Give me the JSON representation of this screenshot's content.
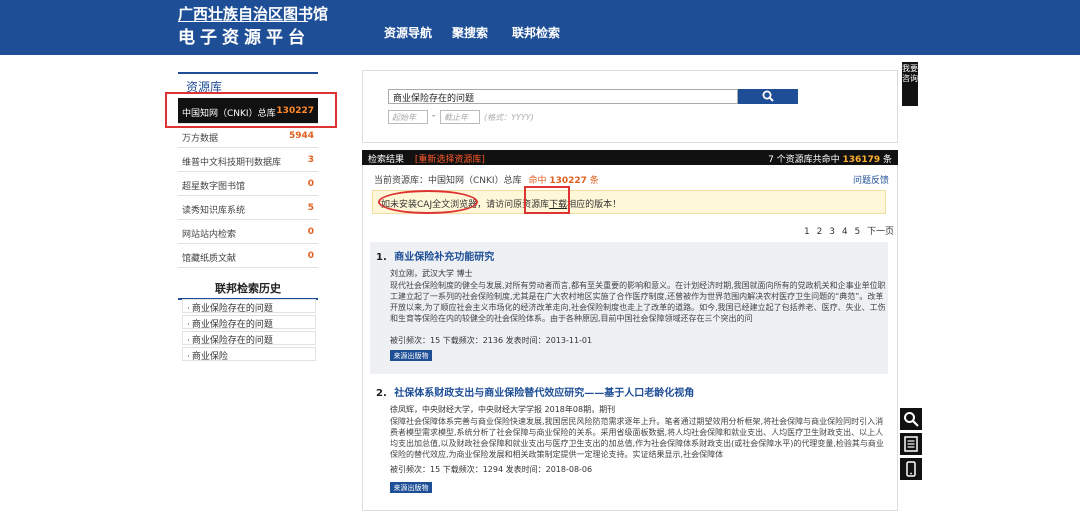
{
  "header": {
    "logo_title": "广西壮族自治区图书馆",
    "logo_subtitle": "电子资源平台",
    "nav": [
      "资源导航",
      "聚搜索",
      "联邦检索"
    ]
  },
  "sidebar": {
    "title": "资源库",
    "databases": [
      {
        "name": "中国知网（CNKI）总库",
        "count": "130227"
      },
      {
        "name": "万方数据",
        "count": "5944"
      },
      {
        "name": "维普中文科技期刊数据库",
        "count": "3"
      },
      {
        "name": "超星数字图书馆",
        "count": "0"
      },
      {
        "name": "读秀知识库系统",
        "count": "5"
      },
      {
        "name": "网站站内检索",
        "count": "0"
      },
      {
        "name": "馆藏纸质文献",
        "count": "0"
      }
    ],
    "history_title": "联邦检索历史",
    "history": [
      "商业保险存在的问题",
      "商业保险存在的问题",
      "商业保险存在的问题",
      "商业保险"
    ]
  },
  "search": {
    "query": "商业保险存在的问题",
    "start_placeholder": "起始年",
    "end_placeholder": "截止年",
    "date_hint": "(格式：YYYY)"
  },
  "results_bar": {
    "label": "检索结果",
    "reselect": "[重新选择资源库]",
    "summary_prefix": "7 个资源库共命中",
    "summary_count": "136179",
    "summary_suffix": "条"
  },
  "current_db": {
    "prefix": "当前资源库：中国知网（CNKI）总库",
    "hits_label": "命中",
    "hits": "130227",
    "hits_suffix": "条"
  },
  "feedback": "问题反馈",
  "notice": {
    "part1": "如未安装CAJ全文浏览器",
    "part2": "，请访问原资源库",
    "link": "下载",
    "part3": "相应的版本！"
  },
  "pager": [
    "1",
    "2",
    "3",
    "4",
    "5",
    "下一页"
  ],
  "results": [
    {
      "num": "1.",
      "title": "商业保险补充功能研究",
      "author": "刘立刚，武汉大学 博士",
      "abstract": "现代社会保险制度的健全与发展,对所有劳动者而言,都有至关重要的影响和意义。在计划经济时期,我国就面向所有的党政机关和企事业单位职工建立起了一系列的社会保险制度,尤其是在广大农村地区实施了合作医疗制度,还曾被作为世界范围内解决农村医疗卫生问题的“典范”。改革开放以来,为了顺应社会主义市场化的经济改革走向,社会保险制度也走上了改革的道路。如今,我国已经建立起了包括养老、医疗、失业、工伤和生育等保险在内的较健全的社会保险体系。由于各种原因,目前中国社会保障领域还存在三个突出的问",
      "stats": "被引频次：15 下载频次：2136 发表时间：2013-11-01",
      "source": "来源出版物"
    },
    {
      "num": "2.",
      "title": "社保体系财政支出与商业保险替代效应研究——基于人口老龄化视角",
      "author": "徐凤辉，中央财经大学，中央财经大学学报 2018年08期，期刊",
      "abstract": "保障社会保障体系完善与商业保险快速发展,我国居民风险防范需求逐年上升。笔者通过期望效用分析框架,将社会保障与商业保险同时引入消费者模型需求模型,系统分析了社会保障与商业保险的关系。采用省级面板数据,将人均社会保障和就业支出、人均医疗卫生财政支出、以上人均支出加总值,以及财政社会保障和就业支出与医疗卫生支出的加总值,作为社会保障体系财政支出(或社会保障水平)的代理变量,检验其与商业保险的替代效应,为商业保险发展和相关政策制定提供一定理论支持。实证结果显示,社会保障体",
      "stats": "被引频次：15 下载频次：1294 发表时间：2018-08-06",
      "source": "来源出版物"
    }
  ],
  "side_tab": "我要咨询",
  "colors": {
    "header_blue": "#1e4f96",
    "count_orange": "#e06020",
    "highlight_red": "#dd3333",
    "notice_bg": "#fff8d8"
  }
}
